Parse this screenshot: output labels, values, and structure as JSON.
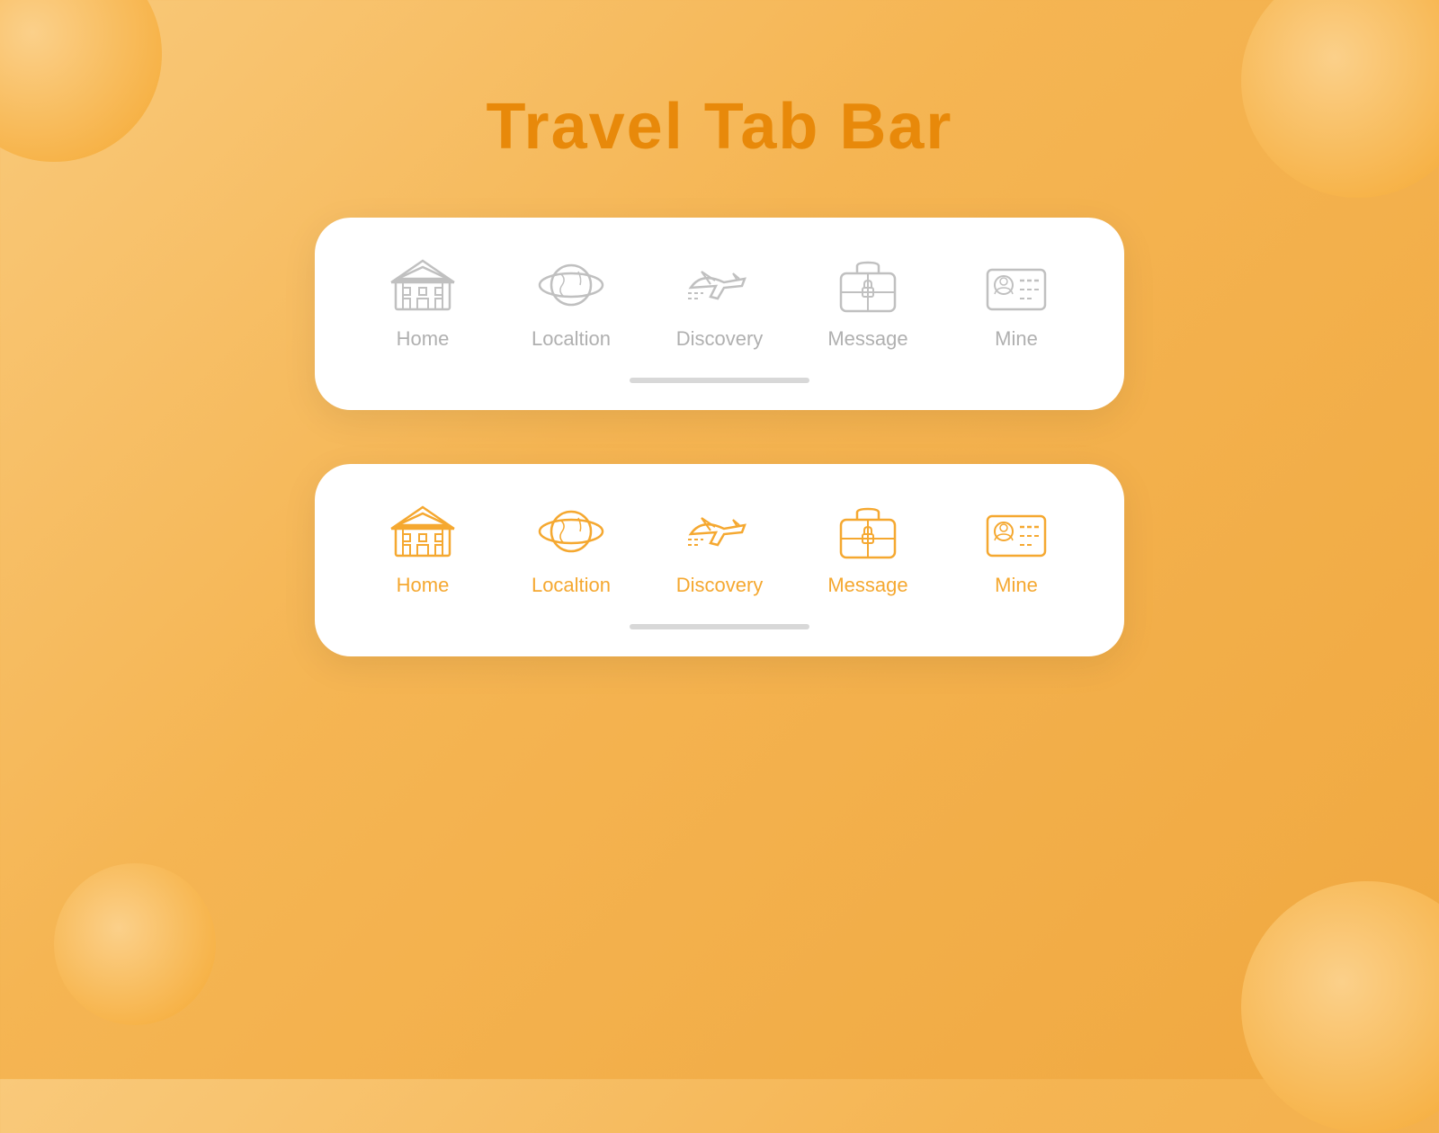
{
  "page": {
    "title": "Travel Tab Bar",
    "background_color": "#f5b553",
    "title_color": "#e8890a"
  },
  "tab_bar_inactive": {
    "items": [
      {
        "id": "home",
        "label": "Home"
      },
      {
        "id": "location",
        "label": "Localtion"
      },
      {
        "id": "discovery",
        "label": "Discovery"
      },
      {
        "id": "message",
        "label": "Message"
      },
      {
        "id": "mine",
        "label": "Mine"
      }
    ],
    "icon_color": "#c0c0c0",
    "label_color": "#b0b0b0"
  },
  "tab_bar_active": {
    "items": [
      {
        "id": "home",
        "label": "Home"
      },
      {
        "id": "location",
        "label": "Localtion"
      },
      {
        "id": "discovery",
        "label": "Discovery"
      },
      {
        "id": "message",
        "label": "Message"
      },
      {
        "id": "mine",
        "label": "Mine"
      }
    ],
    "icon_color": "#f5a830",
    "label_color": "#f5a830"
  }
}
